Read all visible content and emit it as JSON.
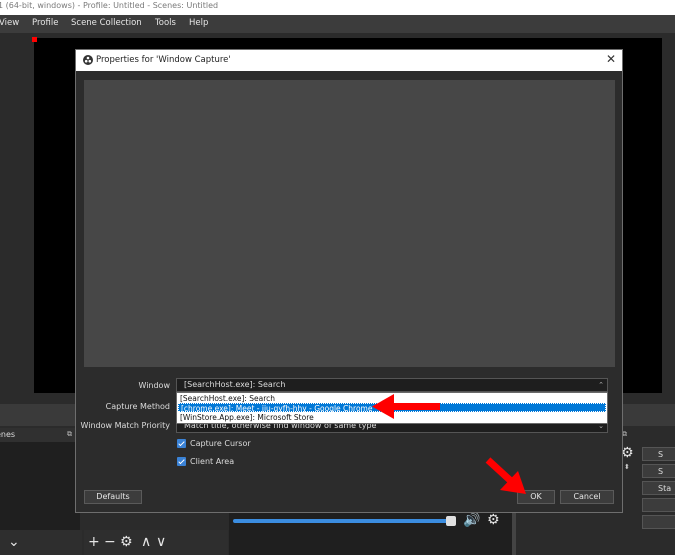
{
  "window": {
    "title": "1 (64-bit, windows) - Profile: Untitled - Scenes: Untitled"
  },
  "menu": [
    "View",
    "Profile",
    "Scene Collection",
    "Tools",
    "Help"
  ],
  "docks": {
    "scenes_title": "enes"
  },
  "right_controls": [
    "S",
    "S",
    "Sta"
  ],
  "dialog": {
    "title": "Properties for 'Window Capture'",
    "window_label": "Window",
    "window_value": "[SearchHost.exe]: Search",
    "capture_method_label": "Capture Method",
    "priority_label": "Window Match Priority",
    "priority_value": "Match title, otherwise find window of same type",
    "dropdown_options": [
      "[SearchHost.exe]: Search",
      "[chrome.exe]: Meet - jiu-qyfh-hhy - Google Chrome",
      "[WinStore.App.exe]: Microsoft Store"
    ],
    "selected_option_index": 1,
    "capture_cursor_label": "Capture Cursor",
    "capture_cursor_checked": true,
    "client_area_label": "Client Area",
    "client_area_checked": true,
    "defaults_label": "Defaults",
    "ok_label": "OK",
    "cancel_label": "Cancel"
  },
  "annotation_color": "#ff0000",
  "accent_color": "#0078d7"
}
